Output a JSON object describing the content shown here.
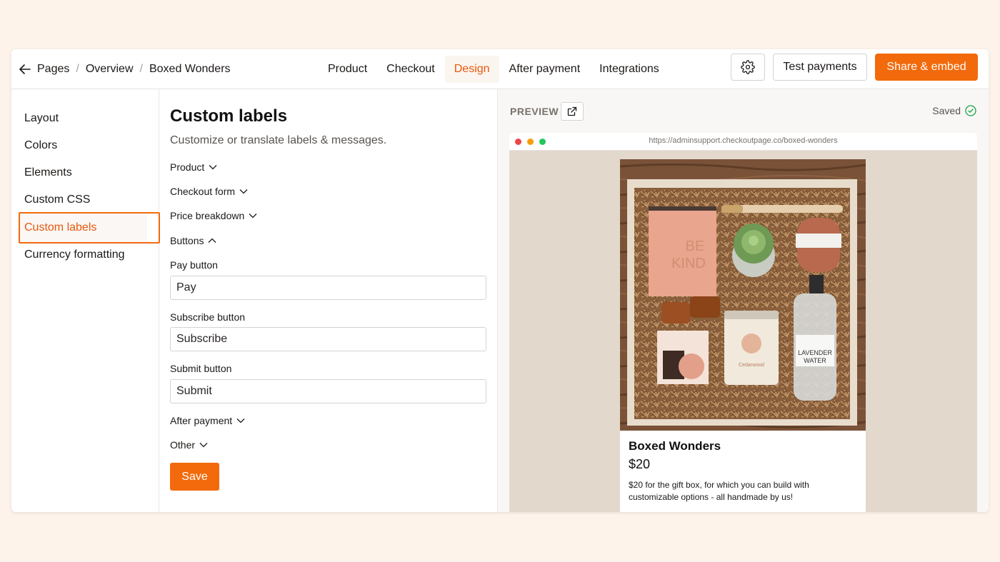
{
  "breadcrumb": {
    "items": [
      "Pages",
      "Overview",
      "Boxed Wonders"
    ],
    "separator": "/"
  },
  "nav": {
    "tabs": [
      "Product",
      "Checkout",
      "Design",
      "After payment",
      "Integrations"
    ],
    "active": "Design"
  },
  "toolbar": {
    "settings_icon": "gear-icon",
    "test_label": "Test payments",
    "share_label": "Share & embed"
  },
  "sidebar": {
    "items": [
      "Layout",
      "Colors",
      "Elements",
      "Custom CSS",
      "Custom labels",
      "Currency formatting"
    ],
    "active": "Custom labels"
  },
  "form": {
    "title": "Custom labels",
    "description": "Customize or translate labels & messages.",
    "sections": {
      "product": "Product",
      "checkout_form": "Checkout form",
      "price_breakdown": "Price breakdown",
      "buttons": "Buttons",
      "after_payment": "After payment",
      "other": "Other"
    },
    "fields": {
      "pay_label": "Pay button",
      "pay_value": "Pay",
      "subscribe_label": "Subscribe button",
      "subscribe_value": "Subscribe",
      "submit_label": "Submit button",
      "submit_value": "Submit"
    },
    "save_label": "Save"
  },
  "preview": {
    "label": "PREVIEW",
    "status": "Saved",
    "url": "https://adminsupport.checkoutpage.co/boxed-wonders",
    "product": {
      "name": "Boxed Wonders",
      "price": "$20",
      "description": "$20 for the gift box, for which you can build with customizable options - all handmade by us!"
    }
  },
  "colors": {
    "accent": "#f26a0c",
    "page_bg": "#fdf3ea",
    "preview_bg": "#e3d8cc"
  }
}
